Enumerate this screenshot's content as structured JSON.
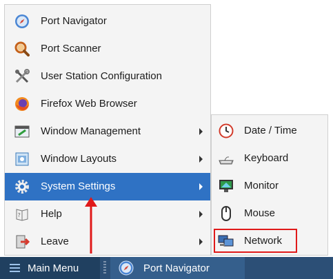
{
  "main_menu": {
    "items": [
      {
        "label": "Port Navigator",
        "icon": "compass-icon",
        "submenu": false
      },
      {
        "label": "Port Scanner",
        "icon": "magnifier-icon",
        "submenu": false
      },
      {
        "label": "User Station Configuration",
        "icon": "tools-icon",
        "submenu": false
      },
      {
        "label": "Firefox Web Browser",
        "icon": "firefox-icon",
        "submenu": false
      },
      {
        "label": "Window Management",
        "icon": "window-management-icon",
        "submenu": true
      },
      {
        "label": "Window Layouts",
        "icon": "window-layouts-icon",
        "submenu": true
      },
      {
        "label": "System Settings",
        "icon": "gear-icon",
        "submenu": true,
        "active": true
      },
      {
        "label": "Help",
        "icon": "help-book-icon",
        "submenu": true
      },
      {
        "label": "Leave",
        "icon": "leave-door-icon",
        "submenu": true
      }
    ]
  },
  "settings_submenu": {
    "items": [
      {
        "label": "Date / Time",
        "icon": "clock-icon"
      },
      {
        "label": "Keyboard",
        "icon": "keyboard-icon"
      },
      {
        "label": "Monitor",
        "icon": "monitor-icon"
      },
      {
        "label": "Mouse",
        "icon": "mouse-icon"
      },
      {
        "label": "Network",
        "icon": "network-icon",
        "highlighted": true
      }
    ]
  },
  "taskbar": {
    "menu_label": "Main Menu",
    "app_label": "Port Navigator"
  },
  "colors": {
    "active_item": "#2f72c4",
    "taskbar": "#2c4f76",
    "annotation": "#e01919"
  }
}
